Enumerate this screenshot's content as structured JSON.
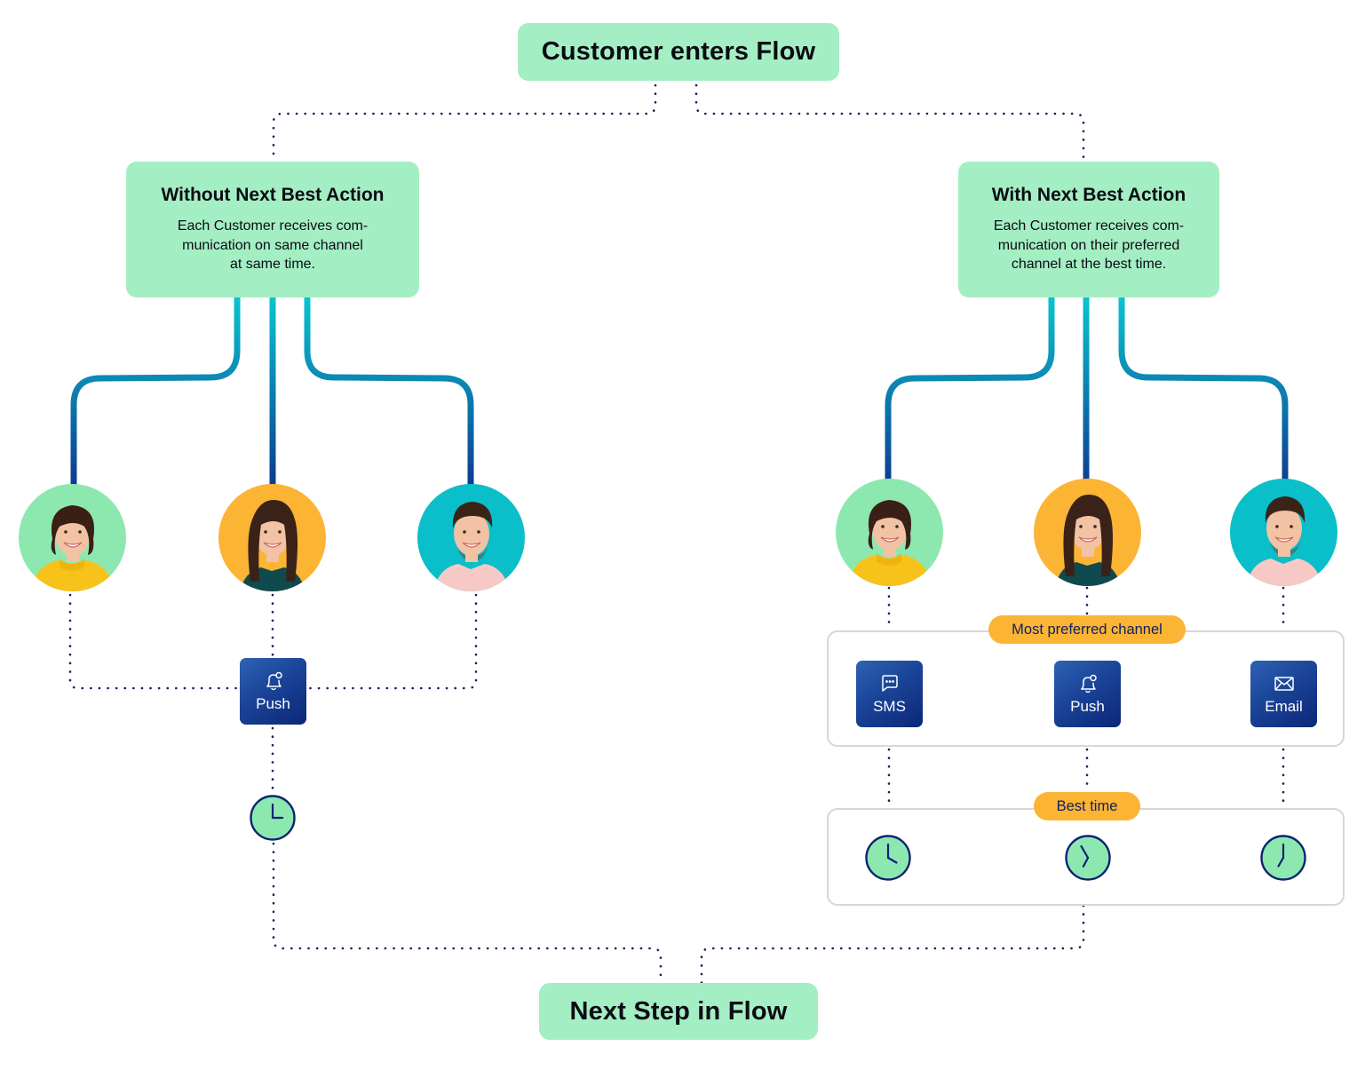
{
  "flow": {
    "start": {
      "label": "Customer enters Flow"
    },
    "end": {
      "label": "Next Step in Flow"
    }
  },
  "branches": {
    "without": {
      "title": "Without Next Best Action",
      "description": "Each Customer receives com-\nmunication on same channel\nat same time.",
      "customers": [
        {
          "name": "customer-woman-short-hair",
          "bg": "#8de8b0"
        },
        {
          "name": "customer-woman-long-hair",
          "bg": "#fbb434"
        },
        {
          "name": "customer-man",
          "bg": "#0abfc9"
        }
      ],
      "channel": {
        "label": "Push",
        "icon": "bell-icon"
      },
      "time": {
        "icon": "clock-icon",
        "hour": 3,
        "minute": 0
      }
    },
    "with": {
      "title": "With Next Best Action",
      "description": "Each Customer receives com-\nmunication on their preferred\nchannel at the best time.",
      "customers": [
        {
          "name": "customer-woman-short-hair",
          "bg": "#8de8b0"
        },
        {
          "name": "customer-woman-long-hair",
          "bg": "#fbb434"
        },
        {
          "name": "customer-man",
          "bg": "#0abfc9"
        }
      ],
      "channel_group_label": "Most preferred channel",
      "channels": [
        {
          "label": "SMS",
          "icon": "chat-bubble-icon"
        },
        {
          "label": "Push",
          "icon": "bell-icon"
        },
        {
          "label": "Email",
          "icon": "envelope-icon"
        }
      ],
      "time_group_label": "Best time",
      "times": [
        {
          "icon": "clock-icon",
          "hour": 4,
          "minute": 0
        },
        {
          "icon": "clock-icon",
          "hour": 6,
          "minute": 55
        },
        {
          "icon": "clock-icon",
          "hour": 7,
          "minute": 0
        }
      ]
    }
  },
  "colors": {
    "box_green": "#a4eec3",
    "dot_navy": "#1b1f5c",
    "channel_blue": "#1a4497",
    "pill_orange": "#fbb434",
    "clock_face": "#8de8b0",
    "clock_stroke": "#0c2470",
    "wire_top": "#0ac4d0",
    "wire_bottom": "#0d3c91"
  }
}
